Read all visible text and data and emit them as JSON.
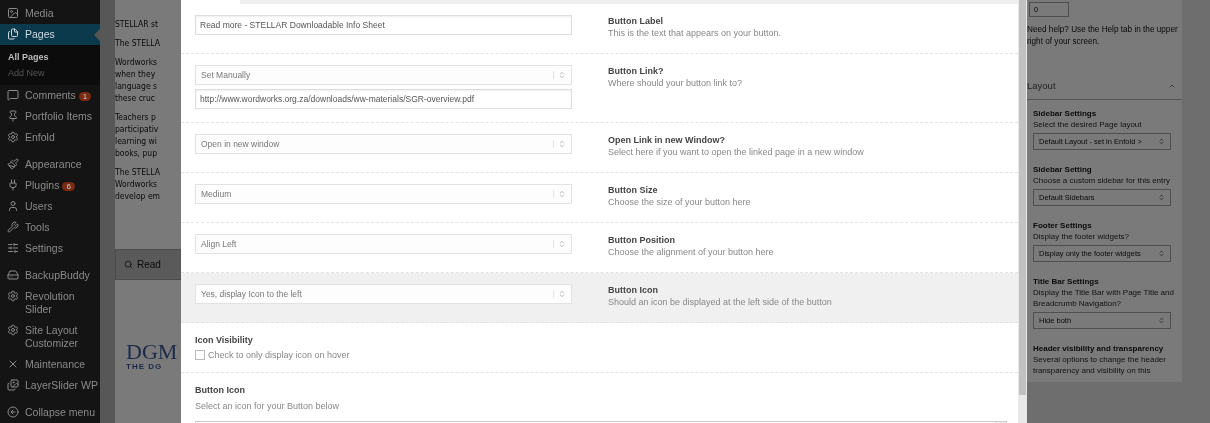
{
  "sidebar": {
    "groups": [
      [
        {
          "label": "Media",
          "selected": false
        },
        {
          "label": "Pages",
          "selected": true,
          "children": [
            {
              "label": "All Pages",
              "selected": true
            },
            {
              "label": "Add New",
              "selected": false
            }
          ]
        },
        {
          "label": "Comments",
          "selected": false,
          "badge": "1"
        },
        {
          "label": "Portfolio Items",
          "selected": false
        },
        {
          "label": "Enfold",
          "selected": false
        }
      ],
      [
        {
          "label": "Appearance",
          "selected": false
        },
        {
          "label": "Plugins",
          "selected": false,
          "badge": "6"
        },
        {
          "label": "Users",
          "selected": false
        },
        {
          "label": "Tools",
          "selected": false
        },
        {
          "label": "Settings",
          "selected": false
        }
      ],
      [
        {
          "label": "BackupBuddy",
          "selected": false
        },
        {
          "label": "Revolution Slider",
          "selected": false
        },
        {
          "label": "Site Layout Customizer",
          "selected": false
        },
        {
          "label": "Maintenance",
          "selected": false
        },
        {
          "label": "LayerSlider WP",
          "selected": false
        }
      ]
    ],
    "collapse": "Collapse menu"
  },
  "editor": {
    "paragraphs": [
      [
        "STELLAR st"
      ],
      [
        "The STELLA"
      ],
      [
        "Wordworks",
        "when they",
        "language s",
        "these cruc"
      ],
      [
        "Teachers p",
        "participativ",
        "learning wi",
        "books, pup"
      ],
      [
        "The STELLA",
        "Wordworks",
        "develop em"
      ]
    ],
    "search_button": "Read",
    "logo": {
      "name": "DGM",
      "tagline": "THE DG"
    }
  },
  "modal": {
    "rows": [
      {
        "kind": "text",
        "value": "Read more - STELLAR Downloadable Info Sheet",
        "title": "Button Label",
        "description": "This is the text that appears on your button.",
        "highlighted": false
      },
      {
        "kind": "link",
        "value": "Set Manually",
        "url": "http://www.wordworks.org.za/downloads/ww-materials/SGR-overview.pdf",
        "title": "Button Link?",
        "description": "Where should your button link to?",
        "highlighted": false
      },
      {
        "kind": "select",
        "value": "Open in new window",
        "title": "Open Link in new Window?",
        "description": "Select here if you want to open the linked page in a new window",
        "highlighted": false
      },
      {
        "kind": "select",
        "value": "Medium",
        "title": "Button Size",
        "description": "Choose the size of your button here",
        "highlighted": false
      },
      {
        "kind": "select",
        "value": "Align Left",
        "title": "Button Position",
        "description": "Choose the alignment of your button here",
        "highlighted": false
      },
      {
        "kind": "select",
        "value": "Yes, display Icon to the left",
        "title": "Button Icon",
        "description": "Should an icon be displayed at the left side of the button",
        "highlighted": true
      },
      {
        "kind": "checkbox",
        "title": "Icon Visibility",
        "label": "Check to only display icon on hover",
        "checked": false,
        "highlighted": false
      },
      {
        "kind": "icon_list",
        "title": "Button Icon",
        "description": "Select an icon for your Button below",
        "highlighted": false
      }
    ]
  },
  "right_panel": {
    "order_value": "0",
    "help": "Need help? Use the Help tab in the upper right of your screen.",
    "layout": {
      "title": "Layout",
      "expanded": true,
      "settings": [
        {
          "title": "Sidebar Settings",
          "description": "Select the desired Page layout",
          "value": "Default Layout - set in Enfold >"
        },
        {
          "title": "Sidebar Setting",
          "description": "Choose a custom sidebar for this entry",
          "value": "Default Sidebars"
        },
        {
          "title": "Footer Settings",
          "description": "Display the footer widgets?",
          "value": "Display only the footer widgets"
        },
        {
          "title": "Title Bar Settings",
          "description": "Display the Title Bar with Page Title and Breadcrumb Navigation?",
          "value": "Hide both"
        },
        {
          "title": "Header visibility and transparency",
          "description": "Several options to change the header transparency and visibility on this"
        }
      ]
    }
  }
}
